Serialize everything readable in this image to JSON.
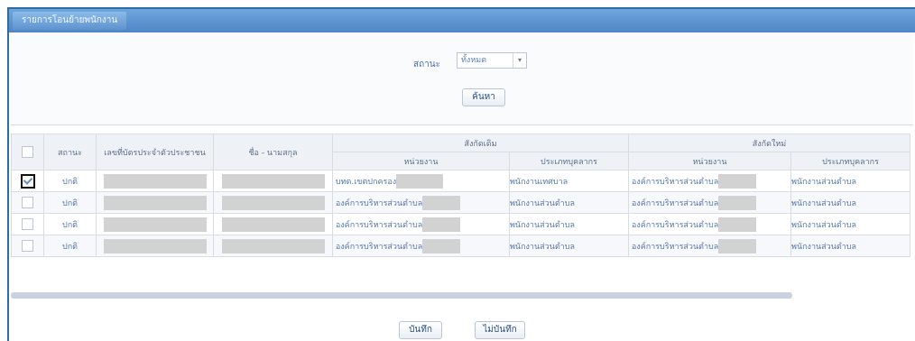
{
  "panel": {
    "title": "รายการโอนย้ายพนักงาน"
  },
  "filter": {
    "status_label": "สถานะ",
    "status_value": "ทั้งหมด",
    "search_label": "ค้นหา"
  },
  "table": {
    "headers": {
      "status": "สถานะ",
      "employee_id": "เลขที่บัตรประจำตัวประชาชน",
      "full_name": "ชื่อ - นามสกุล",
      "old_group": "สังกัดเดิม",
      "new_group": "สังกัดใหม่",
      "office": "หน่วยงาน",
      "position_type": "ประเภทบุคลากร"
    },
    "rows": [
      {
        "checked": true,
        "status": "ปกติ",
        "old_office": "บทต.เขตปกครอง",
        "old_type": "พนักงานเทศบาล",
        "new_office": "องค์การบริหารส่วนตำบล",
        "new_type": "พนักงานส่วนตำบล"
      },
      {
        "checked": false,
        "status": "ปกติ",
        "old_office": "องค์การบริหารส่วนตำบล",
        "old_type": "พนักงานส่วนตำบล",
        "new_office": "องค์การบริหารส่วนตำบล",
        "new_type": "พนักงานส่วนตำบล"
      },
      {
        "checked": false,
        "status": "ปกติ",
        "old_office": "องค์การบริหารส่วนตำบล",
        "old_type": "พนักงานส่วนตำบล",
        "new_office": "องค์การบริหารส่วนตำบล",
        "new_type": "พนักงานส่วนตำบล"
      },
      {
        "checked": false,
        "status": "ปกติ",
        "old_office": "องค์การบริหารส่วนตำบล",
        "old_type": "พนักงานส่วนตำบล",
        "new_office": "องค์การบริหารส่วนตำบล",
        "new_type": "พนักงานส่วนตำบล"
      }
    ]
  },
  "footer": {
    "save_label": "บันทึก",
    "cancel_label": "ไม่บันทึก"
  }
}
